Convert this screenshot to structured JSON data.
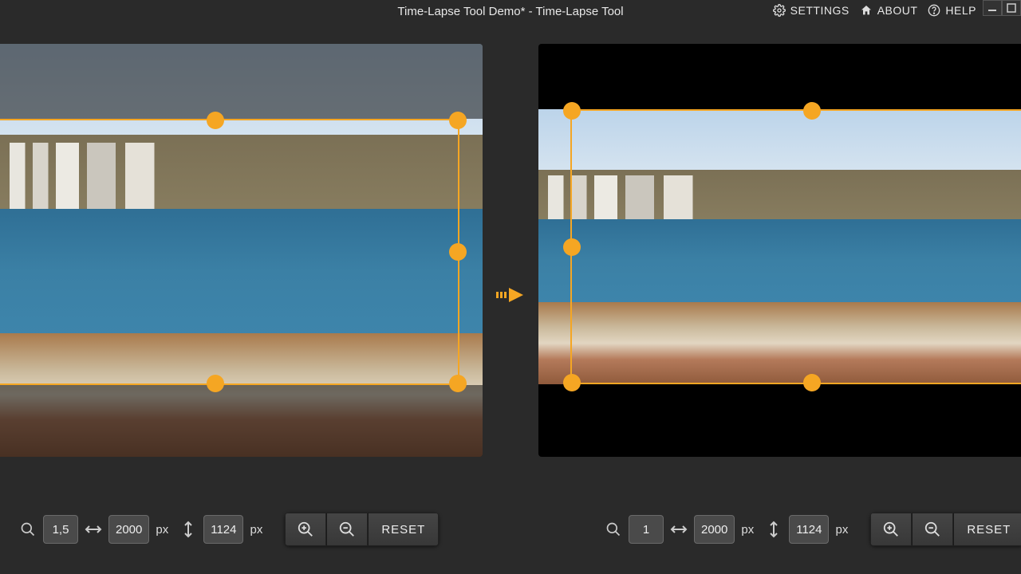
{
  "titlebar": {
    "title": "Time-Lapse Tool Demo* - Time-Lapse Tool"
  },
  "menu": {
    "settings": "SETTINGS",
    "about": "ABOUT",
    "help": "HELP"
  },
  "panels": {
    "left": {
      "zoom": "1,5",
      "width": "2000",
      "height": "1124",
      "unit": "px",
      "reset": "RESET"
    },
    "right": {
      "zoom": "1",
      "width": "2000",
      "height": "1124",
      "unit": "px",
      "reset": "RESET"
    }
  },
  "colors": {
    "accent": "#f5a623",
    "bg": "#2a2a2a"
  }
}
